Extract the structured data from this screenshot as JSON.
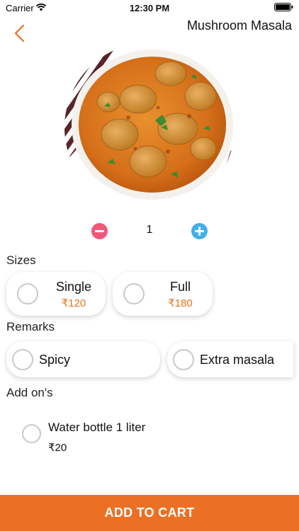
{
  "status_bar": {
    "carrier": "Carrier",
    "time": "12:30 PM"
  },
  "header": {
    "title": "Mushroom Masala",
    "back_icon": "chevron-left-icon"
  },
  "quantity": {
    "value": "1"
  },
  "sizes": {
    "label": "Sizes",
    "options": [
      {
        "name": "Single",
        "price": "₹120",
        "selected": false
      },
      {
        "name": "Full",
        "price": "₹180",
        "selected": false
      }
    ]
  },
  "remarks": {
    "label": "Remarks",
    "options": [
      {
        "name": "Spicy",
        "selected": false
      },
      {
        "name": "Extra masala",
        "selected": false
      }
    ]
  },
  "addons": {
    "label": "Add on's",
    "items": [
      {
        "name": "Water bottle 1 liter",
        "price": "₹20",
        "selected": false
      }
    ]
  },
  "cart_button": {
    "label": "ADD TO CART"
  },
  "colors": {
    "accent": "#ec7023",
    "minus": "#f0587a",
    "plus": "#43aee8",
    "price": "#e8731f"
  }
}
